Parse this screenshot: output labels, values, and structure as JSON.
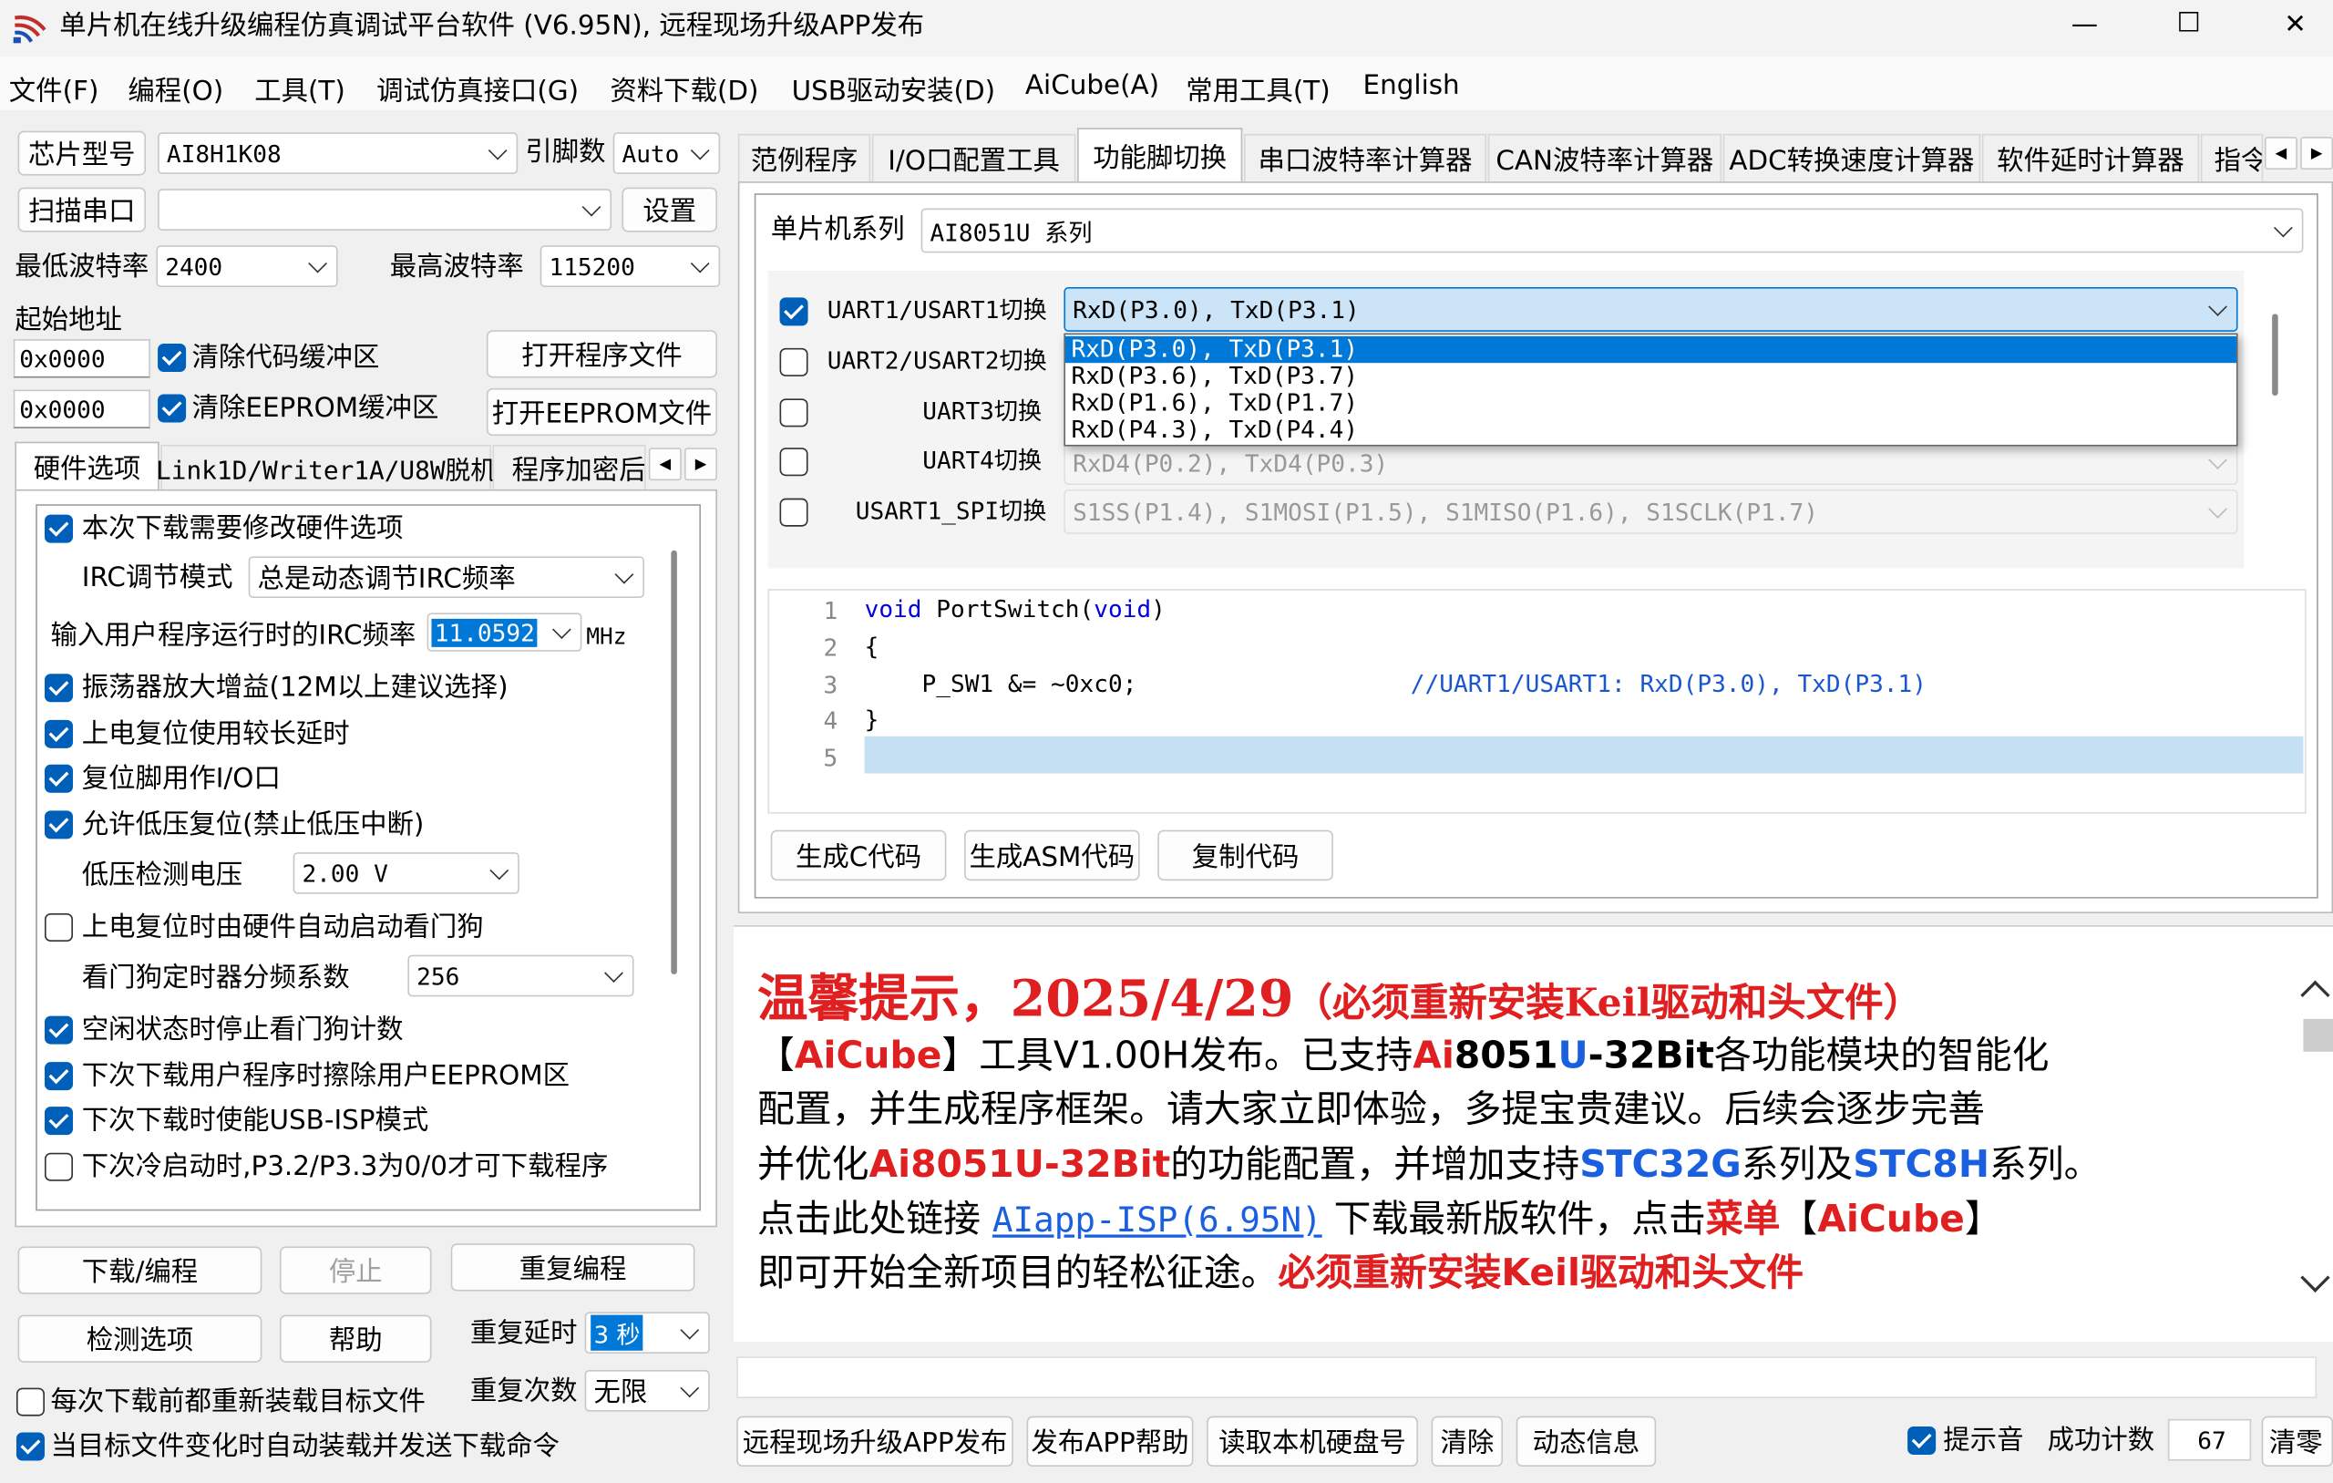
{
  "window": {
    "title": "单片机在线升级编程仿真调试平台软件 (V6.95N), 远程现场升级APP发布",
    "controls": {
      "minimize": "—",
      "maximize": "☐",
      "close": "✕"
    }
  },
  "menubar": [
    "文件(F)",
    "编程(O)",
    "工具(T)",
    "调试仿真接口(G)",
    "资料下载(D)",
    "USB驱动安装(D)",
    "AiCube(A)",
    "常用工具(T)",
    "English"
  ],
  "left": {
    "chip_label": "芯片型号",
    "chip_value": "AI8H1K08",
    "pins_label": "引脚数",
    "pins_value": "Auto",
    "scan_label": "扫描串口",
    "port_value": "",
    "settings_label": "设置",
    "min_baud_label": "最低波特率",
    "min_baud_value": "2400",
    "max_baud_label": "最高波特率",
    "max_baud_value": "115200",
    "start_addr_label": "起始地址",
    "addr1": "0x0000",
    "clear_code_label": "清除代码缓冲区",
    "open_prog_label": "打开程序文件",
    "addr2": "0x0000",
    "clear_eeprom_label": "清除EEPROM缓冲区",
    "open_eeprom_label": "打开EEPROM文件",
    "tabs": [
      "硬件选项",
      "Link1D/Writer1A/U8W脱机",
      "程序加密后"
    ],
    "hw": {
      "modify_hw": "本次下载需要修改硬件选项",
      "irc_mode_label": "IRC调节模式",
      "irc_mode_value": "总是动态调节IRC频率",
      "irc_freq_label": "输入用户程序运行时的IRC频率",
      "irc_freq_value": "11.0592",
      "irc_unit": "MHz",
      "osc_gain": "振荡器放大增益(12M以上建议选择)",
      "long_delay": "上电复位使用较长延时",
      "reset_io": "复位脚用作I/O口",
      "lvr": "允许低压复位(禁止低压中断)",
      "lvd_label": "低压检测电压",
      "lvd_value": "2.00 V",
      "wdt_auto": "上电复位时由硬件自动启动看门狗",
      "wdt_div_label": "看门狗定时器分频系数",
      "wdt_div_value": "256",
      "wdt_idle": "空闲状态时停止看门狗计数",
      "erase_eeprom": "下次下载用户程序时擦除用户EEPROM区",
      "usb_isp": "下次下载时使能USB-ISP模式",
      "cold_boot": "下次冷启动时,P3.2/P3.3为0/0才可下载程序"
    },
    "download_label": "下载/编程",
    "stop_label": "停止",
    "repeat_label": "重复编程",
    "check_label": "检测选项",
    "help_label": "帮助",
    "repeat_delay_label": "重复延时",
    "repeat_delay_value": "3 秒",
    "repeat_count_label": "重复次数",
    "repeat_count_value": "无限",
    "reload_label": "每次下载前都重新装载目标文件",
    "auto_load_label": "当目标文件变化时自动装载并发送下载命令"
  },
  "right": {
    "tabs": [
      "范例程序",
      "I/O口配置工具",
      "功能脚切换",
      "串口波特率计算器",
      "CAN波特率计算器",
      "ADC转换速度计算器",
      "软件延时计算器",
      "指令"
    ],
    "series_label": "单片机系列",
    "series_value": "AI8051U 系列",
    "rows": [
      {
        "label": "UART1/USART1切换",
        "value": "RxD(P3.0), TxD(P3.1)"
      },
      {
        "label": "UART2/USART2切换",
        "value": ""
      },
      {
        "label": "UART3切换",
        "value": ""
      },
      {
        "label": "UART4切换",
        "value": "RxD4(P0.2), TxD4(P0.3)"
      },
      {
        "label": "USART1_SPI切换",
        "value": "S1SS(P1.4), S1MOSI(P1.5), S1MISO(P1.6), S1SCLK(P1.7)"
      }
    ],
    "dropdown_options": [
      "RxD(P3.0), TxD(P3.1)",
      "RxD(P3.6), TxD(P3.7)",
      "RxD(P1.6), TxD(P1.7)",
      "RxD(P4.3), TxD(P4.4)"
    ],
    "code": {
      "line_numbers": [
        "1",
        "2",
        "3",
        "4",
        "5"
      ],
      "l1_kw": "void",
      "l1_fn": " PortSwitch(",
      "l1_kw2": "void",
      "l1_end": ")",
      "l2": "{",
      "l3": "    P_SW1 &= ~0xc0;",
      "l3_comment": "//UART1/USART1: RxD(P3.0), TxD(P3.1)",
      "l4": "}"
    },
    "gen_c_label": "生成C代码",
    "gen_asm_label": "生成ASM代码",
    "copy_label": "复制代码"
  },
  "info": {
    "headline": "温馨提示，2025/4/29",
    "headline_note": "（必须重新安装Keil驱动和头文件）",
    "l2_a": "【",
    "l2_b": "AiCube",
    "l2_c": "】工具V1.00H发布。已支持",
    "l2_d": "Ai",
    "l2_e": "8051",
    "l2_f": "U",
    "l2_g": "-32Bit",
    "l2_h": "各功能模块的智能化",
    "l3": "配置，并生成程序框架。请大家立即体验，多提宝贵建议。后续会逐步完善",
    "l4_a": "并优化",
    "l4_b": "Ai8051U-32Bit",
    "l4_c": "的功能配置，并增加支持",
    "l4_d": "STC32G",
    "l4_e": "系列及",
    "l4_f": "STC8H",
    "l4_g": "系列。",
    "l5_a": "点击此处链接 ",
    "l5_link": "AIapp-ISP(6.95N)",
    "l5_b": " 下载最新版软件，点击",
    "l5_c": "菜单",
    "l5_d": "【",
    "l5_e": "AiCube",
    "l5_f": "】",
    "l6_a": "即可开始全新项目的轻松征途。",
    "l6_b": "必须重新安装Keil驱动和头文件"
  },
  "bottom": {
    "publish_label": "远程现场升级APP发布",
    "publish_help_label": "发布APP帮助",
    "read_disk_label": "读取本机硬盘号",
    "clear_label": "清除",
    "dynamic_label": "动态信息",
    "beep_label": "提示音",
    "success_label": "成功计数",
    "success_value": "67",
    "reset_label": "清零"
  }
}
